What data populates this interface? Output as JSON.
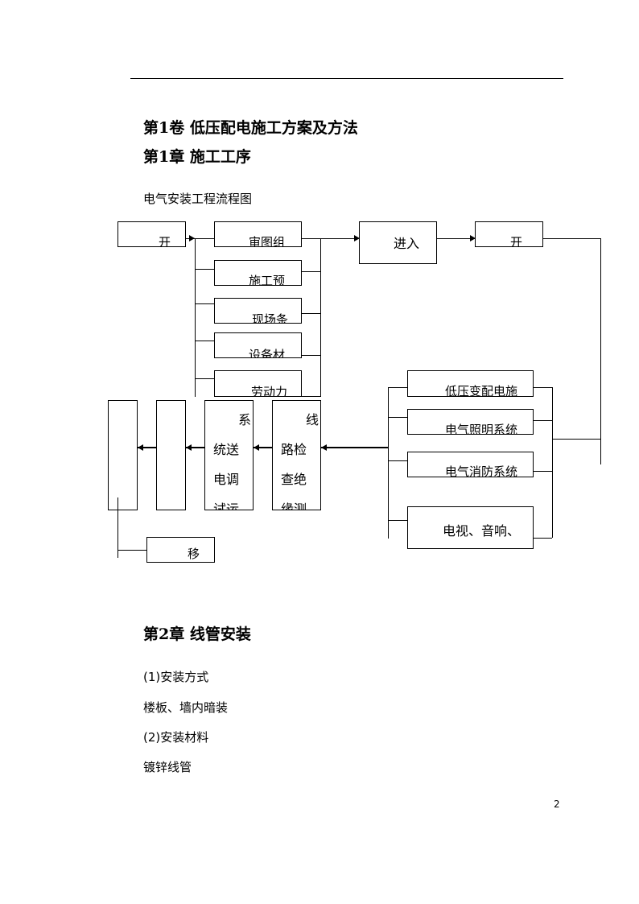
{
  "header": {
    "volume_title": "第1卷 低压配电施工方案及方法",
    "chapter1_title": "第1章 施工工序",
    "flowchart_caption": "电气安装工程流程图"
  },
  "flowchart": {
    "start_box": "开",
    "prep_boxes": [
      "审图组",
      "施工预",
      "现场条",
      "设备材",
      "劳动力"
    ],
    "enter_box": "进入",
    "start2_box": "开",
    "system_boxes": [
      "低压变配电施",
      "电气照明系统",
      "电气消防系统",
      "电视、音响、"
    ],
    "line_check_box": {
      "line1": "线",
      "line2": "路检",
      "line3": "查绝",
      "line4": "缘测"
    },
    "system_debug_box": {
      "line1": "系",
      "line2": "统送",
      "line3": "电调",
      "line4": "试运"
    },
    "blank_box_1": "",
    "blank_box_2": "",
    "handover_box": "移"
  },
  "chapter2": {
    "title": "第2章 线管安装",
    "items": [
      "(1)安装方式",
      "楼板、墙内暗装",
      "(2)安装材料",
      "镀锌线管"
    ]
  },
  "footer": {
    "page_number": "2"
  }
}
